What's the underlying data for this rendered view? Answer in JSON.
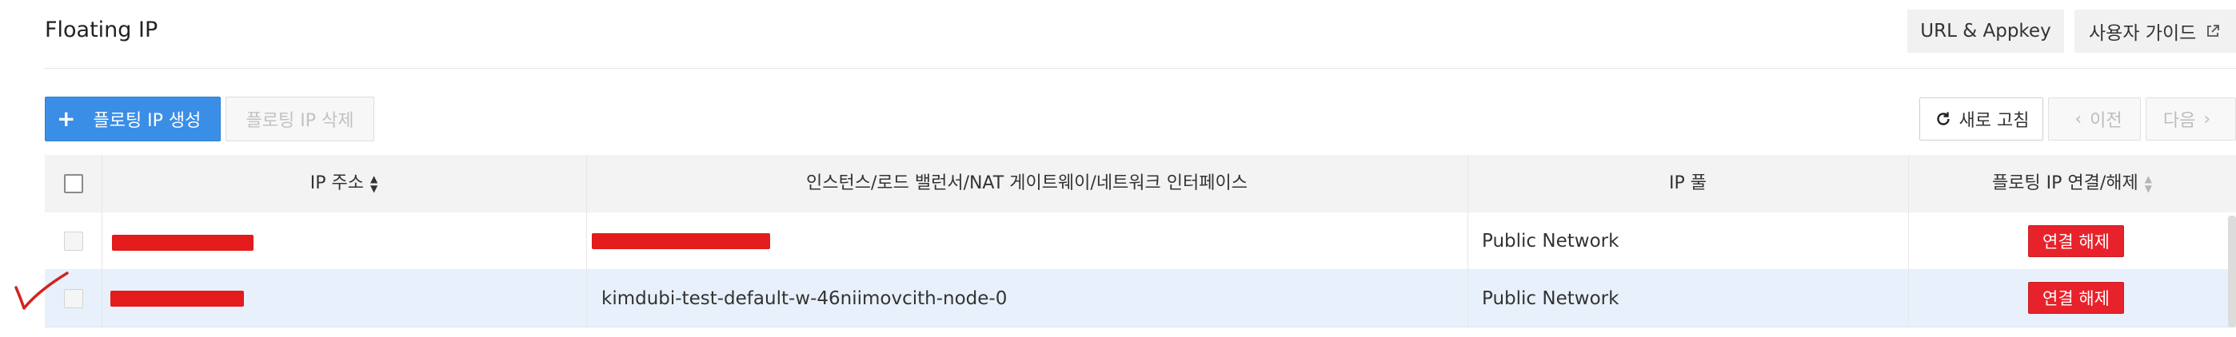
{
  "header": {
    "title": "Floating IP",
    "url_appkey_label": "URL & Appkey",
    "user_guide_label": "사용자 가이드"
  },
  "toolbar": {
    "create_label": "플로팅 IP 생성",
    "delete_label": "플로팅 IP 삭제",
    "refresh_label": "새로 고침",
    "prev_label": "이전",
    "next_label": "다음"
  },
  "table": {
    "columns": [
      "IP 주소",
      "인스턴스/로드 밸런서/NAT 게이트웨이/네트워크 인터페이스",
      "IP 풀",
      "플로팅 IP 연결/해제"
    ],
    "rows": [
      {
        "ip": "",
        "attached": "",
        "pool": "Public Network",
        "action_label": "연결 해제",
        "selected": false
      },
      {
        "ip": "",
        "attached": "kimdubi-test-default-w-46niimovcith-node-0",
        "pool": "Public Network",
        "action_label": "연결 해제",
        "selected": false
      }
    ]
  },
  "colors": {
    "primary": "#3a8ee6",
    "danger": "#e8222b",
    "redaction": "#e31b1b",
    "selected_row": "#e8f1fb",
    "header_bg": "#f3f3f3"
  },
  "icons": {
    "external_link": "external-link-icon",
    "plus": "plus-icon",
    "refresh": "refresh-icon",
    "prev": "chevron-left-icon",
    "next": "chevron-right-icon",
    "sort": "sort-icon"
  }
}
